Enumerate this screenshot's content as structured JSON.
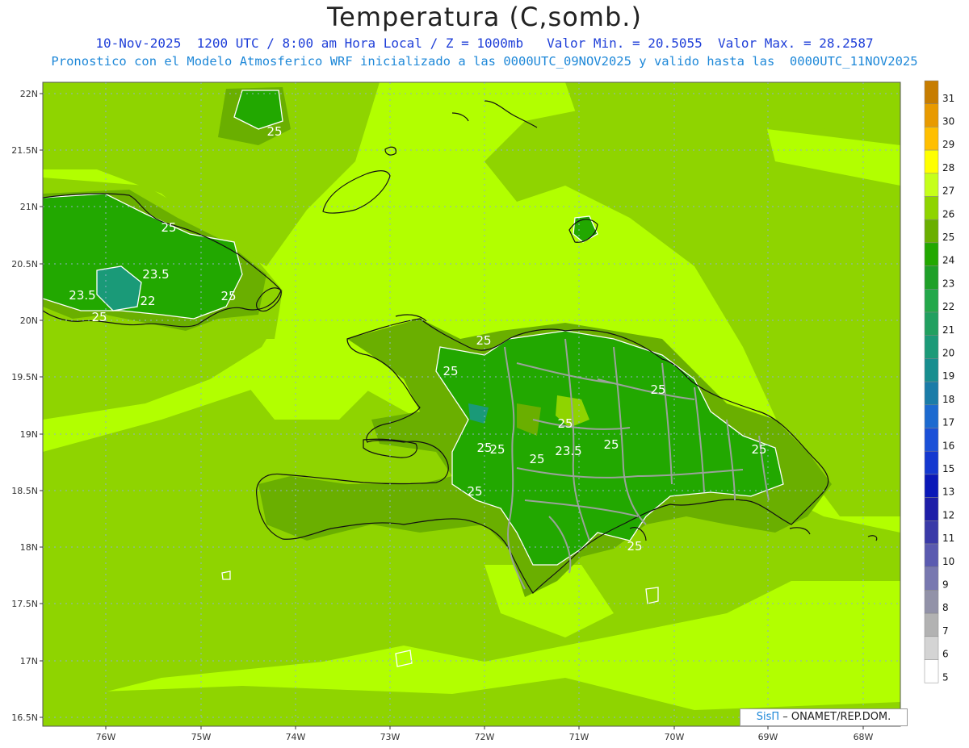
{
  "title": "Temperatura (C,somb.)",
  "subtitle1": "10-Nov-2025  1200 UTC / 8:00 am Hora Local / Z = 1000mb   Valor Min. = 20.5055  Valor Max. = 28.2587",
  "subtitle2": "Pronostico con el Modelo Atmosferico WRF inicializado a las 0000UTC_09NOV2025 y valido hasta las  0000UTC_11NOV2025",
  "credit": {
    "logo": "SisΠ",
    "text": "– ONAMET/REP.DOM."
  },
  "lat_labels": [
    "22N",
    "21.5N",
    "21N",
    "20.5N",
    "20N",
    "19.5N",
    "19N",
    "18.5N",
    "18N",
    "17.5N",
    "17N",
    "16.5N"
  ],
  "lon_labels": [
    "76W",
    "75W",
    "74W",
    "73W",
    "72W",
    "71W",
    "70W",
    "69W",
    "68W"
  ],
  "colorbar": {
    "labels": [
      "31",
      "30",
      "29",
      "28",
      "27",
      "26",
      "25",
      "24",
      "23",
      "22",
      "21",
      "20",
      "19",
      "18",
      "17",
      "16",
      "15",
      "13",
      "12",
      "11",
      "10",
      "9",
      "8",
      "7",
      "6",
      "5"
    ],
    "colors": [
      "#c77d00",
      "#e89a00",
      "#ffbf00",
      "#ffff00",
      "#c6ff1a",
      "#8fd400",
      "#6aaf00",
      "#22a800",
      "#1fa028",
      "#23a84a",
      "#21a060",
      "#1c9a78",
      "#178e8f",
      "#1a7ca8",
      "#1c6ad0",
      "#1a50d8",
      "#1438d0",
      "#0a18b8",
      "#1e1ea8",
      "#3a3aa8",
      "#5a5ab0",
      "#7878b0",
      "#9292a8",
      "#b2b2b2",
      "#d4d4d4",
      "#ffffff"
    ]
  },
  "contour_labels": [
    "25",
    "25",
    "23.5",
    "25",
    "23.5",
    "22",
    "25",
    "25",
    "25",
    "25",
    "25",
    "23.5",
    "25",
    "25",
    "25",
    "25",
    "25",
    "25",
    "25"
  ],
  "legend_colors": {
    "light_green": "#b2ff00",
    "mid_green": "#8fd400",
    "dark_green": "#6aaf00",
    "forest": "#22a800",
    "teal": "#1a9a78"
  }
}
